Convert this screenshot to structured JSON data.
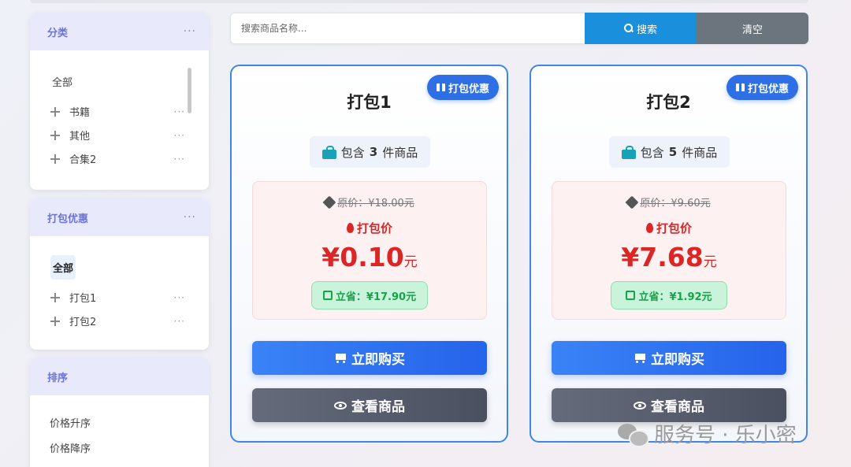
{
  "sidebar": {
    "category": {
      "title": "分类",
      "more": "···",
      "all_label": "全部",
      "items": [
        {
          "label": "书籍",
          "more": "···"
        },
        {
          "label": "其他",
          "more": "···"
        },
        {
          "label": "合集2",
          "more": "···"
        }
      ]
    },
    "bundle": {
      "title": "打包优惠",
      "more": "···",
      "all_label": "全部",
      "items": [
        {
          "label": "打包1",
          "more": "···"
        },
        {
          "label": "打包2",
          "more": "···"
        }
      ]
    },
    "sort": {
      "title": "排序",
      "items": [
        "价格升序",
        "价格降序"
      ]
    }
  },
  "search": {
    "placeholder": "搜索商品名称...",
    "value": "",
    "search_label": "搜索",
    "clear_label": "清空"
  },
  "cards": [
    {
      "badge": "打包优惠",
      "title": "打包1",
      "count_prefix": "包含",
      "count": "3",
      "count_suffix": "件商品",
      "original_price": "原价：¥18.00元",
      "pack_price_label": "打包价",
      "price": "¥0.10",
      "price_unit": "元",
      "savings": "立省：¥17.90元",
      "buy_label": "立即购买",
      "view_label": "查看商品"
    },
    {
      "badge": "打包优惠",
      "title": "打包2",
      "count_prefix": "包含",
      "count": "5",
      "count_suffix": "件商品",
      "original_price": "原价：¥9.60元",
      "pack_price_label": "打包价",
      "price": "¥7.68",
      "price_unit": "元",
      "savings": "立省：¥1.92元",
      "buy_label": "立即购买",
      "view_label": "查看商品"
    }
  ],
  "watermark": "服务号 · 乐小密",
  "colors": {
    "accent": "#2f6fe6",
    "search_button": "#1a8fdb",
    "clear_button": "#6c757d",
    "price_red": "#dc2626",
    "save_green": "#16a34a",
    "panel_header": "#e8eafb",
    "panel_title": "#6b74d6"
  },
  "icons": [
    "search-icon",
    "move-icon",
    "gift-icon",
    "shopping-bag-icon",
    "tag-icon",
    "fire-icon",
    "save-disk-icon",
    "cart-icon",
    "eye-icon",
    "wechat-icon"
  ]
}
